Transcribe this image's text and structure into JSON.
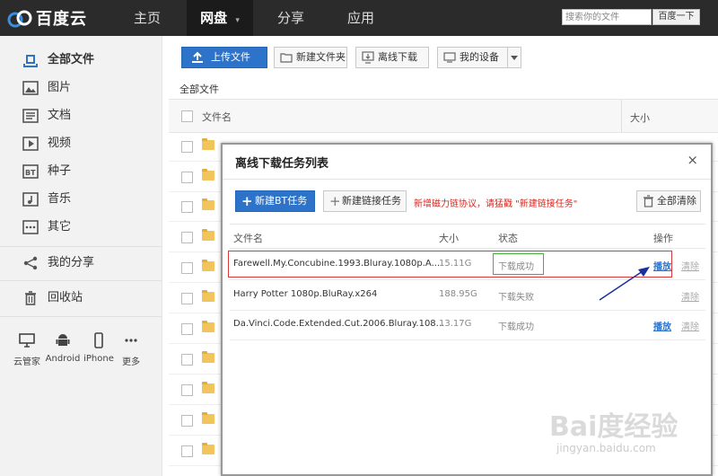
{
  "app": {
    "logo_text": "百度云"
  },
  "nav": {
    "home": "主页",
    "disk": "网盘",
    "share": "分享",
    "apps": "应用"
  },
  "search": {
    "placeholder": "搜索你的文件",
    "button": "百度一下"
  },
  "sidebar": {
    "items": [
      {
        "label": "全部文件",
        "icon": "all-files-icon"
      },
      {
        "label": "图片",
        "icon": "image-icon"
      },
      {
        "label": "文档",
        "icon": "document-icon"
      },
      {
        "label": "视频",
        "icon": "video-icon"
      },
      {
        "label": "种子",
        "icon": "bt-icon"
      },
      {
        "label": "音乐",
        "icon": "music-icon"
      },
      {
        "label": "其它",
        "icon": "other-icon"
      },
      {
        "label": "我的分享",
        "icon": "share-icon"
      },
      {
        "label": "回收站",
        "icon": "trash-icon"
      }
    ],
    "devices": [
      "云管家",
      "Android",
      "iPhone",
      "更多"
    ]
  },
  "toolbar": {
    "upload": "上传文件",
    "new_folder": "新建文件夹",
    "offline": "离线下载",
    "device": "我的设备"
  },
  "breadcrumb": "全部文件",
  "file_table": {
    "col_name": "文件名",
    "col_size": "大小"
  },
  "dialog": {
    "title": "离线下载任务列表",
    "close": "×",
    "new_bt": "新建BT任务",
    "new_link": "新建链接任务",
    "notice": "新增磁力链协议，请猛戳 \"新建链接任务\"",
    "clear_all": "全部清除",
    "headers": {
      "name": "文件名",
      "size": "大小",
      "status": "状态",
      "action": "操作"
    },
    "tasks": [
      {
        "name": "Farewell.My.Concubine.1993.Bluray.1080p.A...",
        "size": "15.11G",
        "status": "下载成功",
        "play": "播放",
        "clear": "清除"
      },
      {
        "name": "Harry Potter 1080p.BluRay.x264",
        "size": "188.95G",
        "status": "下载失败",
        "play": "",
        "clear": "清除"
      },
      {
        "name": "Da.Vinci.Code.Extended.Cut.2006.Bluray.108...",
        "size": "13.17G",
        "status": "下载成功",
        "play": "播放",
        "clear": "清除"
      }
    ]
  },
  "watermark": {
    "main": "Bai度经验",
    "sub": "jingyan.baidu.com"
  },
  "colors": {
    "accent": "#2c73c9",
    "topbar": "#2b2b2b",
    "notice": "#d9261c",
    "highlight_red": "#d83a3a",
    "highlight_green": "#44b23a",
    "arrow": "#1a2fa0"
  }
}
